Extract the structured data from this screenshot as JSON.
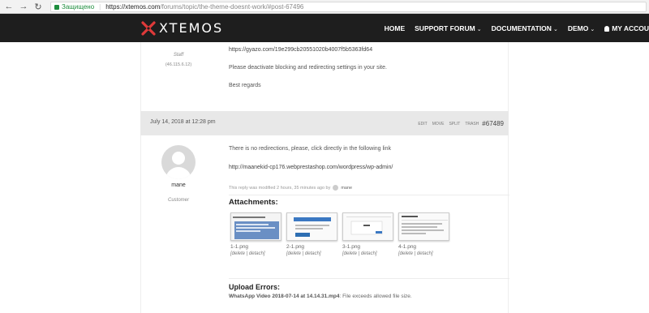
{
  "browser": {
    "secure_label": "Защищено",
    "url_host": "https://xtemos.com",
    "url_path": "/forums/topic/the-theme-doesnt-work/#post-67496"
  },
  "header": {
    "logo_text": "XTEMOS",
    "nav": [
      {
        "label": "HOME",
        "has_dropdown": false
      },
      {
        "label": "SUPPORT FORUM",
        "has_dropdown": true
      },
      {
        "label": "DOCUMENTATION",
        "has_dropdown": true
      },
      {
        "label": "DEMO",
        "has_dropdown": true
      },
      {
        "label": "MY ACCOU",
        "has_dropdown": false
      }
    ],
    "accent_color": "#e03a3a"
  },
  "reply1": {
    "role": "Staff",
    "ip": "(46.115.6.12)",
    "link": "https://gyazo.com/19e299cb20551020b4007f5b5363fd64",
    "text": "Please deactivate blocking and redirecting settings in your site.",
    "regards": "Best regards"
  },
  "reply2_header": {
    "date": "July 14, 2018 at 12:28 pm",
    "actions": [
      "EDIT",
      "MOVE",
      "SPLIT",
      "TRASH"
    ],
    "post_id": "#67489"
  },
  "reply2": {
    "author": "mane",
    "role": "Customer",
    "text": "There is no redirections, please, click directly in the following link",
    "link": "http://maanekid-cp176.webprestashop.com/wordpress/wp-admin/",
    "modified_text": "This reply was modified 2 hours, 35 minutes ago by",
    "modified_author": "mane",
    "attachments_title": "Attachments:",
    "attachments": [
      {
        "name": "1-1.png",
        "actions": "[delete | detach]"
      },
      {
        "name": "2-1.png",
        "actions": "[delete | detach]"
      },
      {
        "name": "3-1.png",
        "actions": "[delete | detach]"
      },
      {
        "name": "4-1.png",
        "actions": "[delete | detach]"
      }
    ],
    "upload_errors_title": "Upload Errors:",
    "upload_error_file": "WhatsApp Video 2018-07-14 at 14.14.31.mp4",
    "upload_error_msg": ": File exceeds allowed file size."
  }
}
